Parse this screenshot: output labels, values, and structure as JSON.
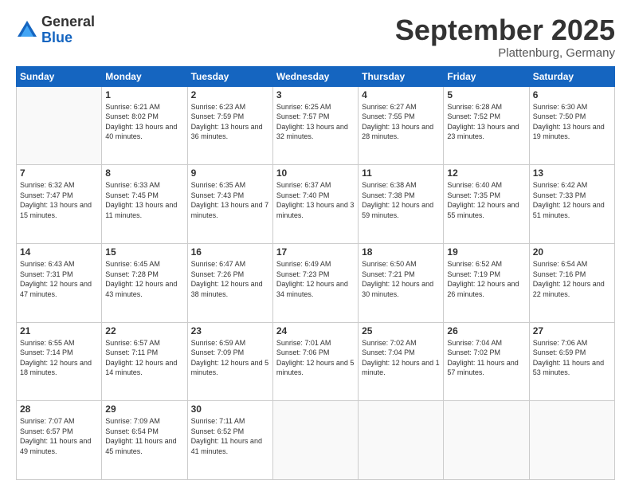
{
  "header": {
    "logo": {
      "general": "General",
      "blue": "Blue"
    },
    "title": "September 2025",
    "location": "Plattenburg, Germany"
  },
  "days_of_week": [
    "Sunday",
    "Monday",
    "Tuesday",
    "Wednesday",
    "Thursday",
    "Friday",
    "Saturday"
  ],
  "weeks": [
    [
      {
        "num": "",
        "sunrise": "",
        "sunset": "",
        "daylight": "",
        "empty": true
      },
      {
        "num": "1",
        "sunrise": "Sunrise: 6:21 AM",
        "sunset": "Sunset: 8:02 PM",
        "daylight": "Daylight: 13 hours and 40 minutes."
      },
      {
        "num": "2",
        "sunrise": "Sunrise: 6:23 AM",
        "sunset": "Sunset: 7:59 PM",
        "daylight": "Daylight: 13 hours and 36 minutes."
      },
      {
        "num": "3",
        "sunrise": "Sunrise: 6:25 AM",
        "sunset": "Sunset: 7:57 PM",
        "daylight": "Daylight: 13 hours and 32 minutes."
      },
      {
        "num": "4",
        "sunrise": "Sunrise: 6:27 AM",
        "sunset": "Sunset: 7:55 PM",
        "daylight": "Daylight: 13 hours and 28 minutes."
      },
      {
        "num": "5",
        "sunrise": "Sunrise: 6:28 AM",
        "sunset": "Sunset: 7:52 PM",
        "daylight": "Daylight: 13 hours and 23 minutes."
      },
      {
        "num": "6",
        "sunrise": "Sunrise: 6:30 AM",
        "sunset": "Sunset: 7:50 PM",
        "daylight": "Daylight: 13 hours and 19 minutes."
      }
    ],
    [
      {
        "num": "7",
        "sunrise": "Sunrise: 6:32 AM",
        "sunset": "Sunset: 7:47 PM",
        "daylight": "Daylight: 13 hours and 15 minutes."
      },
      {
        "num": "8",
        "sunrise": "Sunrise: 6:33 AM",
        "sunset": "Sunset: 7:45 PM",
        "daylight": "Daylight: 13 hours and 11 minutes."
      },
      {
        "num": "9",
        "sunrise": "Sunrise: 6:35 AM",
        "sunset": "Sunset: 7:43 PM",
        "daylight": "Daylight: 13 hours and 7 minutes."
      },
      {
        "num": "10",
        "sunrise": "Sunrise: 6:37 AM",
        "sunset": "Sunset: 7:40 PM",
        "daylight": "Daylight: 13 hours and 3 minutes."
      },
      {
        "num": "11",
        "sunrise": "Sunrise: 6:38 AM",
        "sunset": "Sunset: 7:38 PM",
        "daylight": "Daylight: 12 hours and 59 minutes."
      },
      {
        "num": "12",
        "sunrise": "Sunrise: 6:40 AM",
        "sunset": "Sunset: 7:35 PM",
        "daylight": "Daylight: 12 hours and 55 minutes."
      },
      {
        "num": "13",
        "sunrise": "Sunrise: 6:42 AM",
        "sunset": "Sunset: 7:33 PM",
        "daylight": "Daylight: 12 hours and 51 minutes."
      }
    ],
    [
      {
        "num": "14",
        "sunrise": "Sunrise: 6:43 AM",
        "sunset": "Sunset: 7:31 PM",
        "daylight": "Daylight: 12 hours and 47 minutes."
      },
      {
        "num": "15",
        "sunrise": "Sunrise: 6:45 AM",
        "sunset": "Sunset: 7:28 PM",
        "daylight": "Daylight: 12 hours and 43 minutes."
      },
      {
        "num": "16",
        "sunrise": "Sunrise: 6:47 AM",
        "sunset": "Sunset: 7:26 PM",
        "daylight": "Daylight: 12 hours and 38 minutes."
      },
      {
        "num": "17",
        "sunrise": "Sunrise: 6:49 AM",
        "sunset": "Sunset: 7:23 PM",
        "daylight": "Daylight: 12 hours and 34 minutes."
      },
      {
        "num": "18",
        "sunrise": "Sunrise: 6:50 AM",
        "sunset": "Sunset: 7:21 PM",
        "daylight": "Daylight: 12 hours and 30 minutes."
      },
      {
        "num": "19",
        "sunrise": "Sunrise: 6:52 AM",
        "sunset": "Sunset: 7:19 PM",
        "daylight": "Daylight: 12 hours and 26 minutes."
      },
      {
        "num": "20",
        "sunrise": "Sunrise: 6:54 AM",
        "sunset": "Sunset: 7:16 PM",
        "daylight": "Daylight: 12 hours and 22 minutes."
      }
    ],
    [
      {
        "num": "21",
        "sunrise": "Sunrise: 6:55 AM",
        "sunset": "Sunset: 7:14 PM",
        "daylight": "Daylight: 12 hours and 18 minutes."
      },
      {
        "num": "22",
        "sunrise": "Sunrise: 6:57 AM",
        "sunset": "Sunset: 7:11 PM",
        "daylight": "Daylight: 12 hours and 14 minutes."
      },
      {
        "num": "23",
        "sunrise": "Sunrise: 6:59 AM",
        "sunset": "Sunset: 7:09 PM",
        "daylight": "Daylight: 12 hours and 5 minutes."
      },
      {
        "num": "24",
        "sunrise": "Sunrise: 7:01 AM",
        "sunset": "Sunset: 7:06 PM",
        "daylight": "Daylight: 12 hours and 5 minutes."
      },
      {
        "num": "25",
        "sunrise": "Sunrise: 7:02 AM",
        "sunset": "Sunset: 7:04 PM",
        "daylight": "Daylight: 12 hours and 1 minute."
      },
      {
        "num": "26",
        "sunrise": "Sunrise: 7:04 AM",
        "sunset": "Sunset: 7:02 PM",
        "daylight": "Daylight: 11 hours and 57 minutes."
      },
      {
        "num": "27",
        "sunrise": "Sunrise: 7:06 AM",
        "sunset": "Sunset: 6:59 PM",
        "daylight": "Daylight: 11 hours and 53 minutes."
      }
    ],
    [
      {
        "num": "28",
        "sunrise": "Sunrise: 7:07 AM",
        "sunset": "Sunset: 6:57 PM",
        "daylight": "Daylight: 11 hours and 49 minutes."
      },
      {
        "num": "29",
        "sunrise": "Sunrise: 7:09 AM",
        "sunset": "Sunset: 6:54 PM",
        "daylight": "Daylight: 11 hours and 45 minutes."
      },
      {
        "num": "30",
        "sunrise": "Sunrise: 7:11 AM",
        "sunset": "Sunset: 6:52 PM",
        "daylight": "Daylight: 11 hours and 41 minutes."
      },
      {
        "num": "",
        "sunrise": "",
        "sunset": "",
        "daylight": "",
        "empty": true
      },
      {
        "num": "",
        "sunrise": "",
        "sunset": "",
        "daylight": "",
        "empty": true
      },
      {
        "num": "",
        "sunrise": "",
        "sunset": "",
        "daylight": "",
        "empty": true
      },
      {
        "num": "",
        "sunrise": "",
        "sunset": "",
        "daylight": "",
        "empty": true
      }
    ]
  ]
}
